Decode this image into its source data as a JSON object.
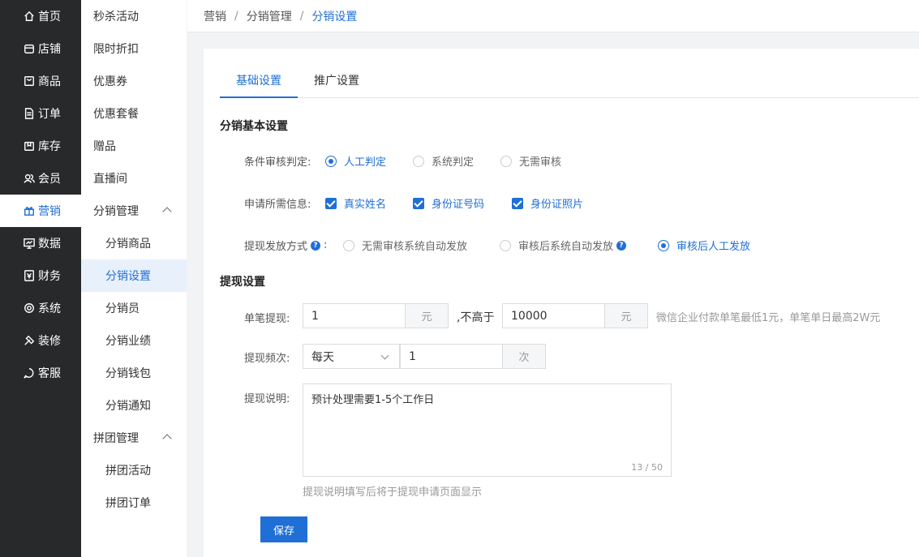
{
  "nav": [
    {
      "label": "首页",
      "icon": "home-icon"
    },
    {
      "label": "店铺",
      "icon": "store-icon"
    },
    {
      "label": "商品",
      "icon": "product-icon"
    },
    {
      "label": "订单",
      "icon": "order-icon"
    },
    {
      "label": "库存",
      "icon": "inventory-icon"
    },
    {
      "label": "会员",
      "icon": "member-icon"
    },
    {
      "label": "营销",
      "icon": "gift-icon",
      "active": true
    },
    {
      "label": "数据",
      "icon": "data-icon"
    },
    {
      "label": "财务",
      "icon": "finance-icon"
    },
    {
      "label": "系统",
      "icon": "settings-icon"
    },
    {
      "label": "装修",
      "icon": "decorate-icon"
    },
    {
      "label": "客服",
      "icon": "chat-icon"
    }
  ],
  "sub": [
    {
      "label": "秒杀活动"
    },
    {
      "label": "限时折扣"
    },
    {
      "label": "优惠券"
    },
    {
      "label": "优惠套餐"
    },
    {
      "label": "赠品"
    },
    {
      "label": "直播间"
    },
    {
      "label": "分销管理",
      "group": true
    },
    {
      "label": "分销商品",
      "child": true
    },
    {
      "label": "分销设置",
      "child": true,
      "active": true
    },
    {
      "label": "分销员",
      "child": true
    },
    {
      "label": "分销业绩",
      "child": true
    },
    {
      "label": "分销钱包",
      "child": true
    },
    {
      "label": "分销通知",
      "child": true
    },
    {
      "label": "拼团管理",
      "group": true
    },
    {
      "label": "拼团活动",
      "child": true
    },
    {
      "label": "拼团订单",
      "child": true
    }
  ],
  "breadcrumb": {
    "a": "营销",
    "sep": "/",
    "b": "分销管理",
    "c": "分销设置"
  },
  "tabs": {
    "basic": "基础设置",
    "promo": "推广设置"
  },
  "basic": {
    "title": "分销基本设置",
    "audit": {
      "label": "条件审核判定:",
      "opt1": "人工判定",
      "opt2": "系统判定",
      "opt3": "无需审核",
      "selected": "人工判定"
    },
    "info": {
      "label": "申请所需信息:",
      "opt1": "真实姓名",
      "opt2": "身份证号码",
      "opt3": "身份证照片"
    },
    "payout": {
      "label": "提现发放方式",
      "colon": ":",
      "opt1": "无需审核系统自动发放",
      "opt2": "审核后系统自动发放",
      "opt3": "审核后人工发放",
      "selected": "审核后人工发放"
    }
  },
  "withdraw": {
    "title": "提现设置",
    "single": {
      "label": "单笔提现:",
      "min": "1",
      "unit": "元",
      "mid": ",不高于",
      "max": "10000",
      "unit2": "元",
      "hint": "微信企业付款单笔最低1元，单笔单日最高2W元"
    },
    "freq": {
      "label": "提现频次:",
      "period": "每天",
      "count": "1",
      "unit": "次"
    },
    "desc": {
      "label": "提现说明:",
      "value": "预计处理需要1-5个工作日",
      "counter": "13 / 50",
      "hint": "提现说明填写后将于提现申请页面显示"
    },
    "save": "保存"
  }
}
